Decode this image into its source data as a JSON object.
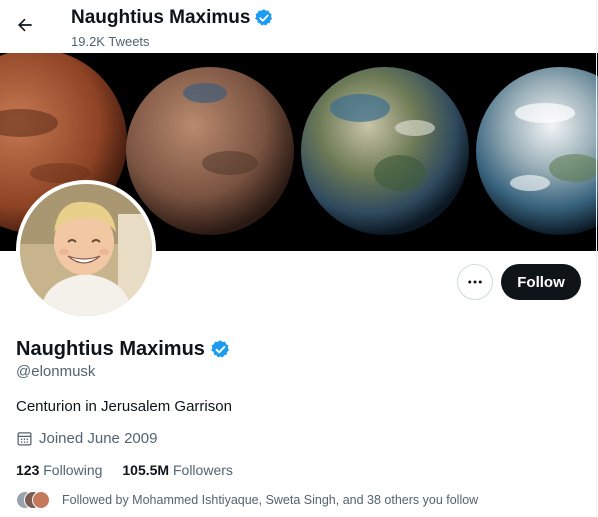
{
  "header": {
    "name": "Naughtius Maximus",
    "tweet_count": "19.2K Tweets",
    "back_icon": "arrow-left-icon"
  },
  "profile": {
    "name": "Naughtius Maximus",
    "verified": true,
    "handle": "@elonmusk",
    "bio": "Centurion in Jerusalem Garrison",
    "joined": "Joined June 2009",
    "following_count": "123",
    "following_label": "Following",
    "followers_count": "105.5M",
    "followers_label": "Followers",
    "followed_by": "Followed by Mohammed Ishtiyaque, Sweta Singh, and 38 others you follow"
  },
  "actions": {
    "more_icon": "more-horizontal-icon",
    "follow_label": "Follow"
  },
  "colors": {
    "text": "#0f1419",
    "secondary": "#536471",
    "verified": "#1d9bf0",
    "follow_bg": "#0f1419"
  }
}
